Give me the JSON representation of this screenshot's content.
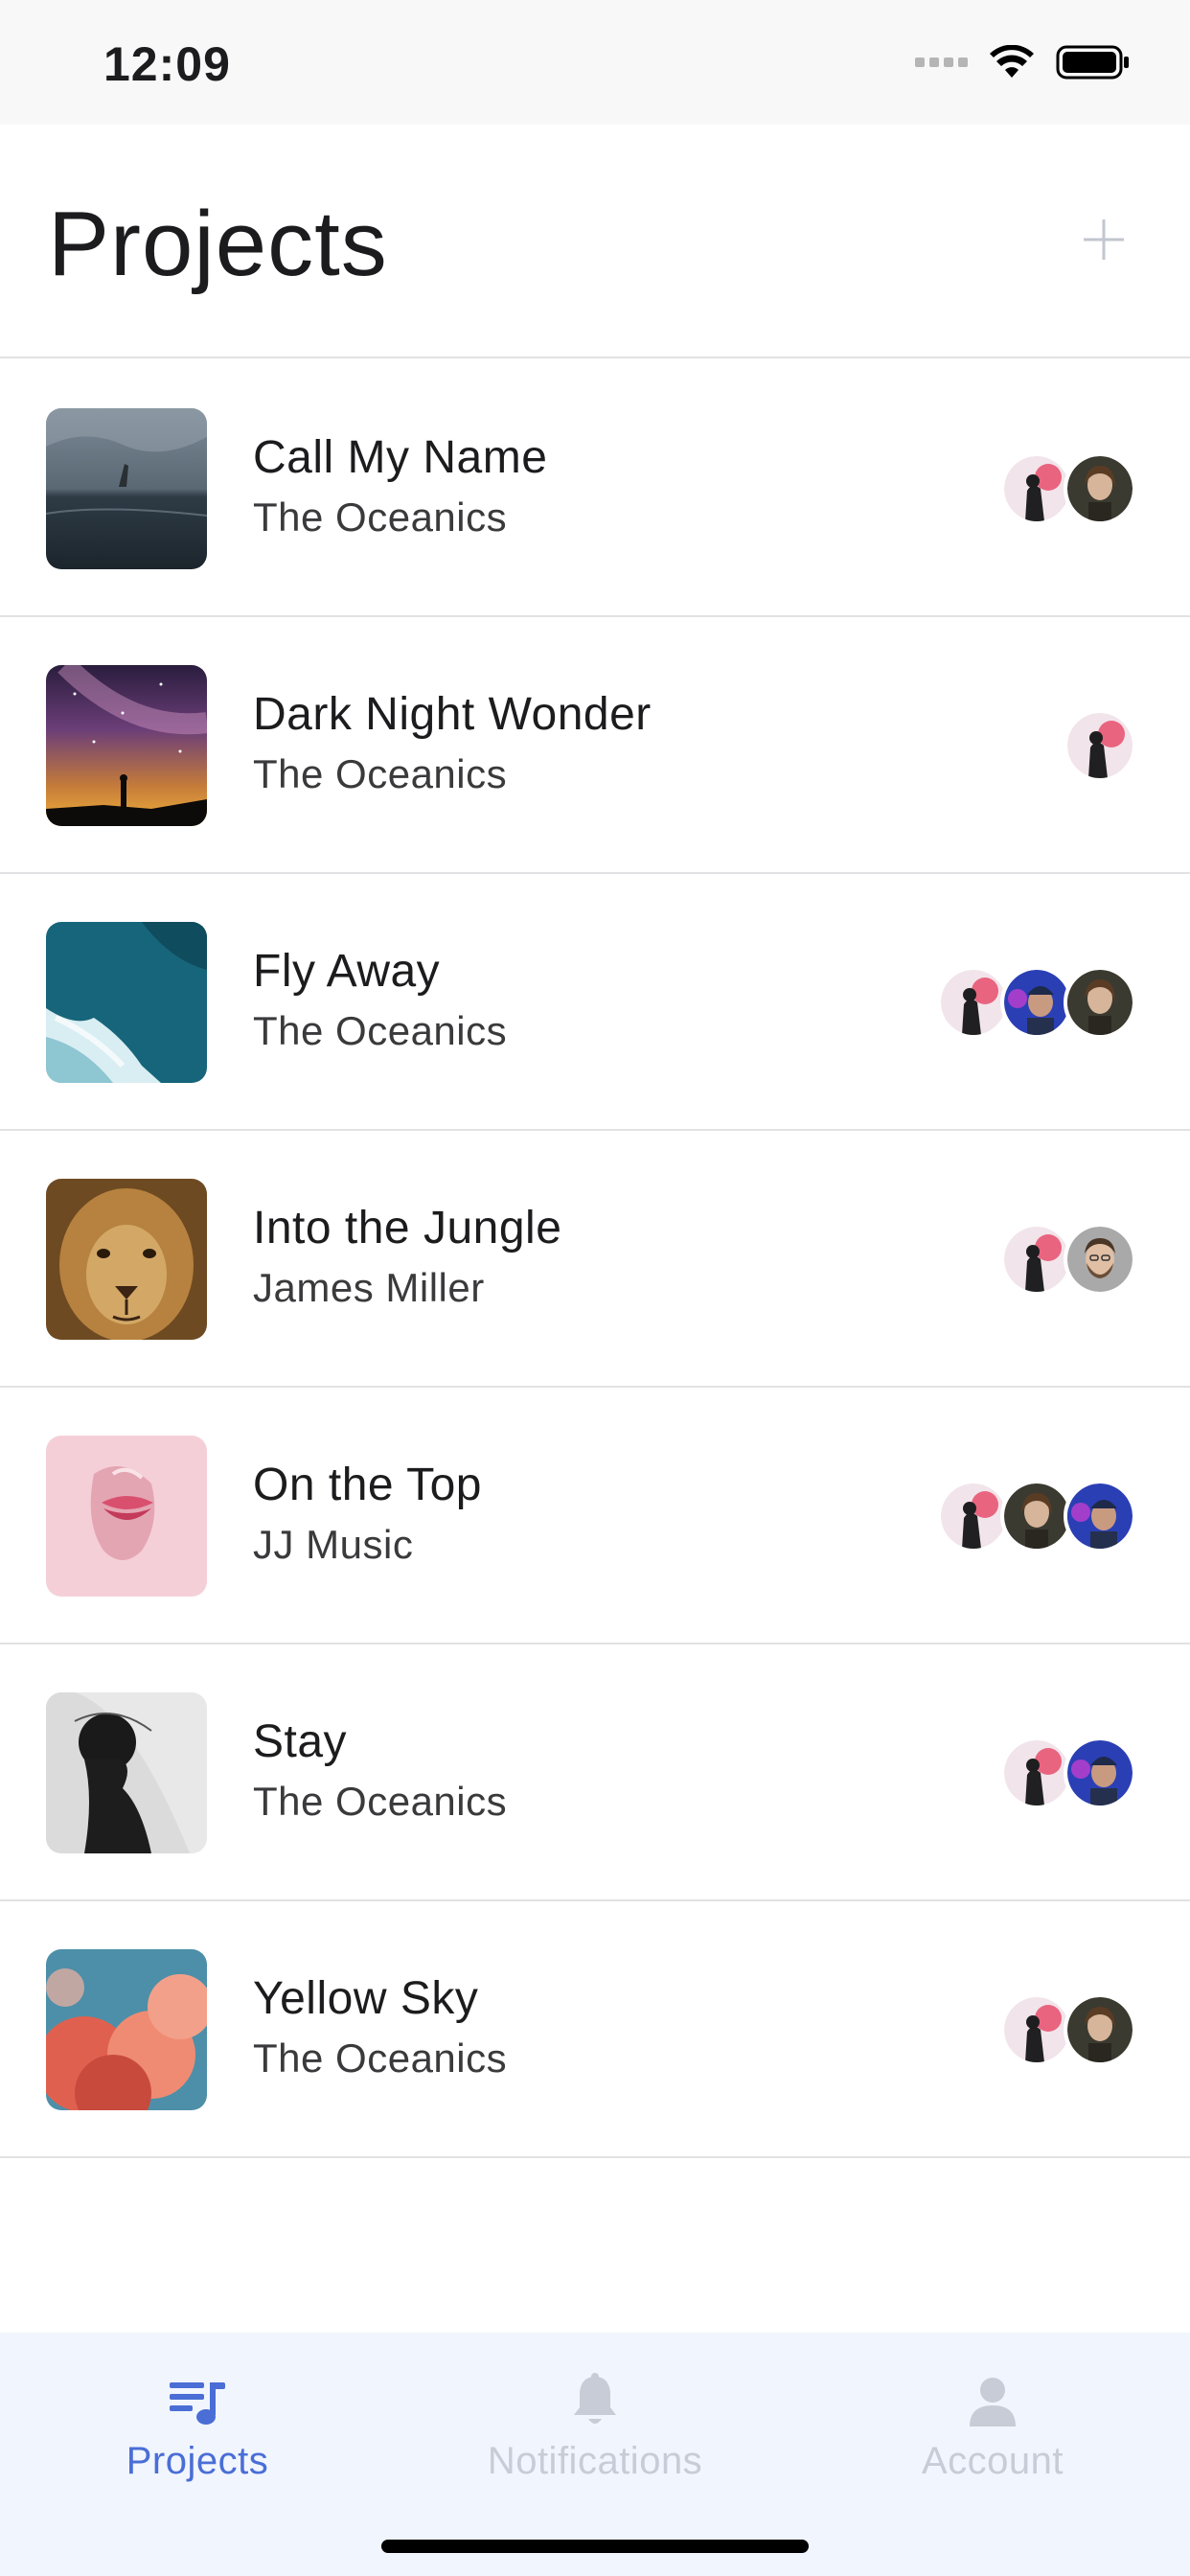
{
  "status_bar": {
    "time": "12:09"
  },
  "header": {
    "title": "Projects"
  },
  "projects": [
    {
      "title": "Call My Name",
      "artist": "The Oceanics",
      "cover": "stormy-sea-hand",
      "avatars": [
        "woman-portrait",
        "punk-girl-pink"
      ]
    },
    {
      "title": "Dark Night Wonder",
      "artist": "The Oceanics",
      "cover": "milky-way-night",
      "avatars": [
        "punk-girl-pink"
      ]
    },
    {
      "title": "Fly Away",
      "artist": "The Oceanics",
      "cover": "ocean-waves-aerial",
      "avatars": [
        "woman-portrait",
        "man-neon-blue",
        "punk-girl-pink"
      ]
    },
    {
      "title": "Into the Jungle",
      "artist": "James Miller",
      "cover": "lion-face",
      "avatars": [
        "bearded-man",
        "punk-girl-pink"
      ]
    },
    {
      "title": "On the Top",
      "artist": "JJ Music",
      "cover": "pink-lips-paper",
      "avatars": [
        "man-neon-blue",
        "woman-portrait",
        "punk-girl-pink"
      ]
    },
    {
      "title": "Stay",
      "artist": "The Oceanics",
      "cover": "silhouette-veil",
      "avatars": [
        "man-neon-blue",
        "punk-girl-pink"
      ]
    },
    {
      "title": "Yellow Sky",
      "artist": "The Oceanics",
      "cover": "pink-clouds",
      "avatars": [
        "woman-portrait",
        "punk-girl-pink"
      ]
    }
  ],
  "tabs": [
    {
      "label": "Projects",
      "icon": "playlist-icon",
      "active": true
    },
    {
      "label": "Notifications",
      "icon": "bell-icon",
      "active": false
    },
    {
      "label": "Account",
      "icon": "person-icon",
      "active": false
    }
  ],
  "colors": {
    "accent": "#4a6ed6",
    "inactive": "#c7ccd6",
    "tabbar_bg": "#f1f5fd",
    "divider": "#e2e2e4"
  }
}
